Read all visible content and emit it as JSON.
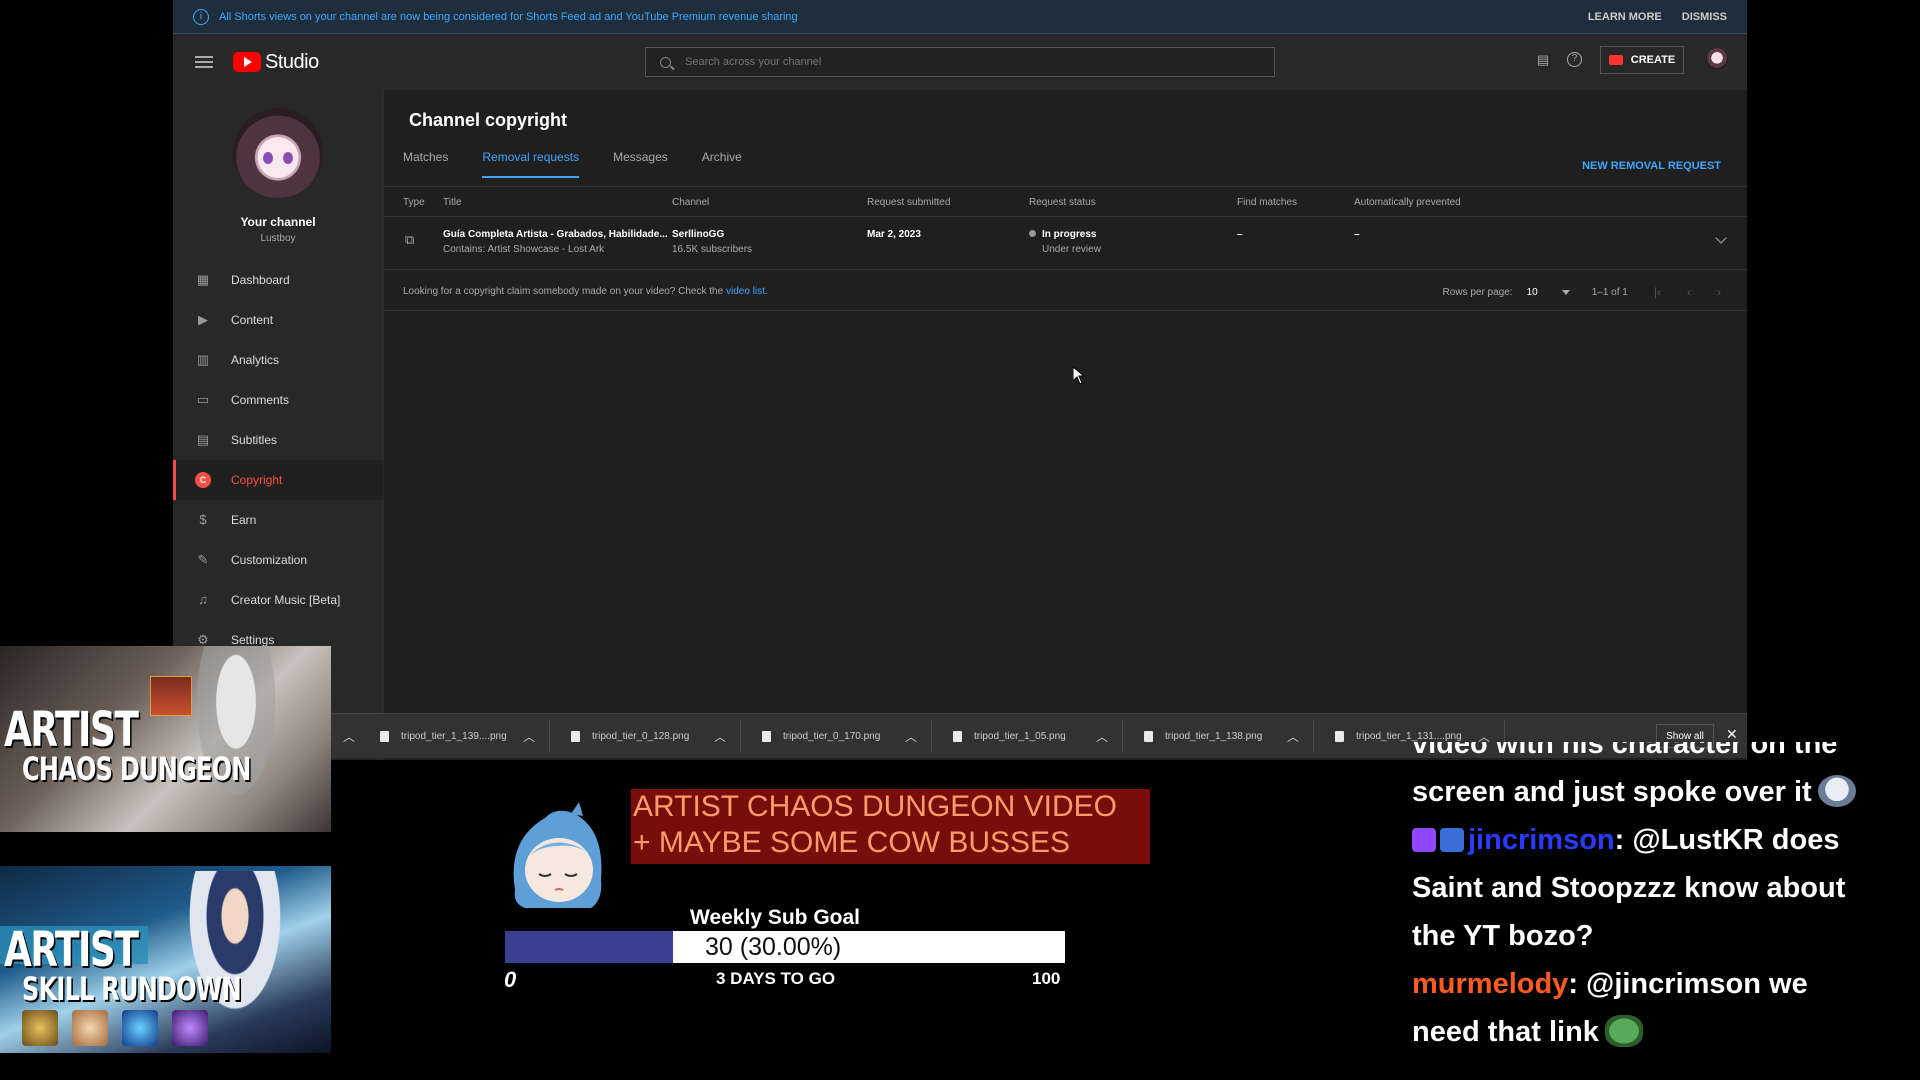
{
  "banner": {
    "message": "All Shorts views on your channel are now being considered for Shorts Feed ad and YouTube Premium revenue sharing",
    "learn_more": "LEARN MORE",
    "dismiss": "DISMISS"
  },
  "topbar": {
    "logo_text": "Studio",
    "search_placeholder": "Search across your channel",
    "create_label": "CREATE"
  },
  "sidebar": {
    "channel_label": "Your channel",
    "channel_handle": "Lustboy",
    "items": [
      {
        "label": "Dashboard",
        "icon": "dashboard-icon"
      },
      {
        "label": "Content",
        "icon": "content-icon"
      },
      {
        "label": "Analytics",
        "icon": "analytics-icon"
      },
      {
        "label": "Comments",
        "icon": "comments-icon"
      },
      {
        "label": "Subtitles",
        "icon": "subtitles-icon"
      },
      {
        "label": "Copyright",
        "icon": "copyright-icon",
        "active": true
      },
      {
        "label": "Earn",
        "icon": "dollar-icon"
      },
      {
        "label": "Customization",
        "icon": "magic-wand-icon"
      },
      {
        "label": "Creator Music [Beta]",
        "icon": "music-icon"
      },
      {
        "label": "Settings",
        "icon": "gear-icon"
      }
    ]
  },
  "main": {
    "title": "Channel copyright",
    "tabs": [
      "Matches",
      "Removal requests",
      "Messages",
      "Archive"
    ],
    "active_tab": "Removal requests",
    "new_request": "NEW REMOVAL REQUEST",
    "columns": [
      "Type",
      "Title",
      "Channel",
      "Request submitted",
      "Request status",
      "Find matches",
      "Automatically prevented"
    ],
    "rows": [
      {
        "title": "Guía Completa Artista - Grabados, Habilidade...",
        "subtitle": "Contains: Artist Showcase - Lost Ark",
        "channel": "SerllinoGG",
        "subscribers": "16.5K subscribers",
        "submitted": "Mar 2, 2023",
        "status": "In progress",
        "status_detail": "Under review",
        "find_matches": "–",
        "auto_prevented": "–"
      }
    ],
    "footer_hint": "Looking for a copyright claim somebody made on your video? Check the",
    "footer_link": "video list.",
    "rows_per_page_label": "Rows per page:",
    "rows_per_page": "10",
    "range": "1–1 of 1"
  },
  "downloads": {
    "files": [
      "tripod_tier_1_139....png",
      "tripod_tier_0_128.png",
      "tripod_tier_0_170.png",
      "tripod_tier_1_05.png",
      "tripod_tier_1_138.png",
      "tripod_tier_1_131....png"
    ],
    "show_all": "Show all"
  },
  "stream": {
    "thumb1": {
      "line1": "ARTIST",
      "line2": "CHAOS DUNGEON"
    },
    "thumb2": {
      "line1": "ARTIST",
      "line2": "SKILL RUNDOWN"
    },
    "title_line1": "ARTIST CHAOS DUNGEON VIDEO",
    "title_line2": "+ MAYBE SOME COW BUSSES",
    "goal": {
      "label": "Weekly Sub Goal",
      "current": 30,
      "target": 100,
      "progress_fraction": 0.3,
      "progress_text": "30 (30.00%)",
      "min_label": "0",
      "max_label": "100",
      "days_left": "3 DAYS TO GO"
    }
  },
  "chat": {
    "line0": "video with his character on the",
    "line1": "screen and just spoke over it",
    "msg1_user": "jincrimson",
    "msg1_l1": ": @LustKR does",
    "msg1_l2": "Saint and Stoopzzz know about",
    "msg1_l3": "the YT bozo?",
    "msg2_user": "murmelody",
    "msg2_l1": ": @jincrimson we",
    "msg2_l2": "need that link"
  },
  "colors": {
    "accent_blue": "#3ea6ff",
    "brand_red": "#ff0000",
    "active_nav": "#ff4e45",
    "goal_fill": "#3b3f91",
    "title_bg": "#7a0c0c",
    "title_text": "#ff9a6a"
  }
}
